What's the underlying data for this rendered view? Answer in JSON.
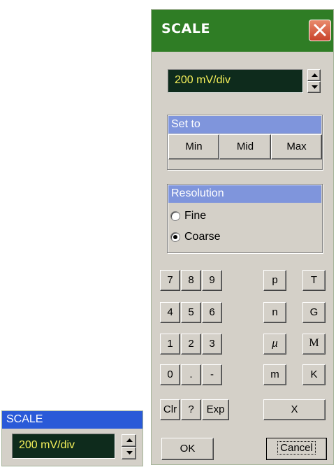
{
  "dialog": {
    "title": "SCALE",
    "value": "200 mV/div",
    "set_to": {
      "header": "Set to",
      "min": "Min",
      "mid": "Mid",
      "max": "Max"
    },
    "resolution": {
      "header": "Resolution",
      "options": [
        "Fine",
        "Coarse"
      ],
      "selected": "Coarse"
    },
    "keypad": {
      "digits": [
        "7",
        "8",
        "9",
        "4",
        "5",
        "6",
        "1",
        "2",
        "3",
        "0",
        ".",
        "-"
      ],
      "prefixes": [
        "p",
        "T",
        "n",
        "G",
        "µ",
        "M",
        "m",
        "K"
      ],
      "clr": "Clr",
      "help": "?",
      "exp": "Exp",
      "x": "X"
    },
    "ok": "OK",
    "cancel": "Cancel"
  },
  "mini_panel": {
    "title": "SCALE",
    "value": "200 mV/div"
  },
  "colors": {
    "titlebar": "#2f7d25",
    "display_bg": "#0e2b1c",
    "display_text": "#f5f05a",
    "group_header": "#7f95dc",
    "mini_titlebar": "#2a5ad8"
  }
}
